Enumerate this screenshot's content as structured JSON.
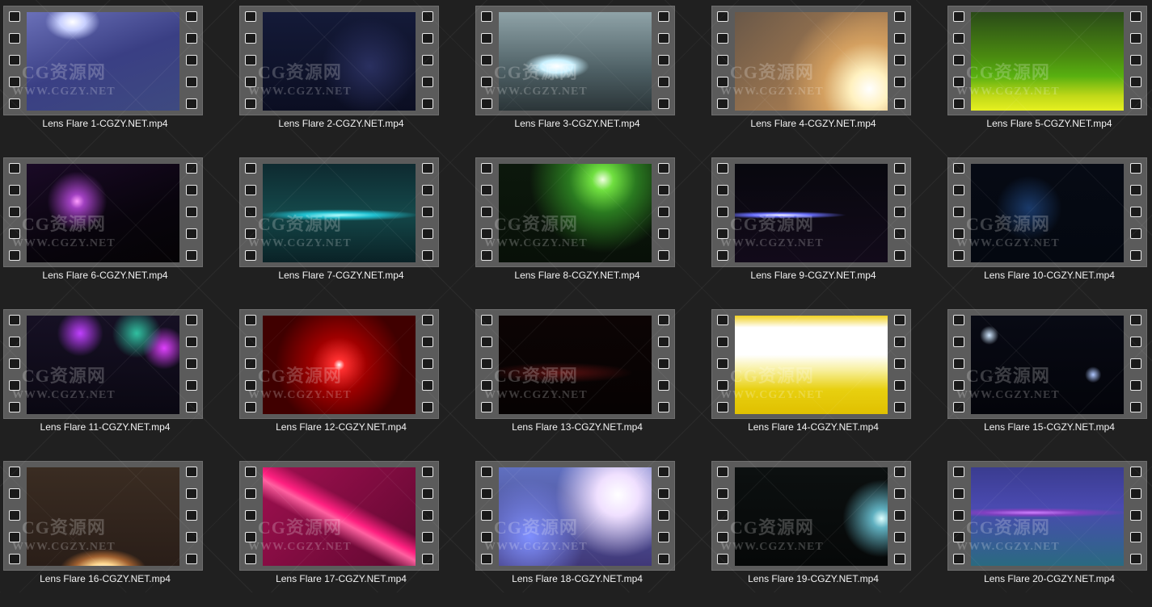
{
  "files": [
    {
      "name": "Lens Flare 1-CGZY.NET.mp4",
      "thumb_bg": "radial-gradient(ellipse 45px 30px at 30% 10%, #ffffff 0%, #c8d0ff 35%, transparent 75%), linear-gradient(160deg,#6a70b8 0%,#3a3f84 50%,#3e4a80 100%)"
    },
    {
      "name": "Lens Flare 2-CGZY.NET.mp4",
      "thumb_bg": "radial-gradient(circle at 70% 55%, #2a3060 0%, transparent 40%), linear-gradient(180deg,#141a38 0%,#0b0e22 100%)"
    },
    {
      "name": "Lens Flare 3-CGZY.NET.mp4",
      "thumb_bg": "radial-gradient(ellipse 50px 20px at 38% 55%, #ffffff 0%, #c9f1ff 40%, transparent 80%), linear-gradient(180deg,#8fa3a8 0%,#4d5f64 60%,#2b3538 100%)"
    },
    {
      "name": "Lens Flare 4-CGZY.NET.mp4",
      "thumb_bg": "radial-gradient(circle at 88% 78%, #ffffff 0%, #fff1c0 12%, #d4a060 30%, transparent 55%), linear-gradient(135deg,#6a5848 0%,#a07850 60%,#b08050 100%)"
    },
    {
      "name": "Lens Flare 5-CGZY.NET.mp4",
      "thumb_bg": "linear-gradient(180deg,#2a4a18 0%,#4a8a10 45%,#58b010 65%,#c0d818 85%,#e6f020 100%)"
    },
    {
      "name": "Lens Flare 6-CGZY.NET.mp4",
      "thumb_bg": "radial-gradient(circle at 33% 38%, #ff9cff 0%, #a040c0 6%, transparent 25%), linear-gradient(160deg,#1a0a26 0%,#08040c 60%,#050305 100%)"
    },
    {
      "name": "Lens Flare 7-CGZY.NET.mp4",
      "thumb_bg": "radial-gradient(ellipse 110px 8px at 50% 52%, #b0ffff 0%, #20c0d0 40%, transparent 90%), linear-gradient(180deg,#0e2a30 0%,#14484a 50%,#0a2226 100%)"
    },
    {
      "name": "Lens Flare 8-CGZY.NET.mp4",
      "thumb_bg": "radial-gradient(circle at 68% 16%, #f0ffe0 0%, #70e040 8%, #2a7a20 25%, transparent 55%), linear-gradient(180deg,#0c180c 0%,#081008 100%)"
    },
    {
      "name": "Lens Flare 9-CGZY.NET.mp4",
      "thumb_bg": "radial-gradient(ellipse 90px 5px at 30% 52%, #ffffff 0%, #6a70ff 40%, transparent 90%), linear-gradient(180deg,#08080e 0%,#120a1a 100%)"
    },
    {
      "name": "Lens Flare 10-CGZY.NET.mp4",
      "thumb_bg": "radial-gradient(circle at 38% 45%, #1a3a6a 0%, transparent 30%), linear-gradient(180deg,#060a14 0%,#040810 100%)"
    },
    {
      "name": "Lens Flare 11-CGZY.NET.mp4",
      "thumb_bg": "radial-gradient(circle at 35% 18%, #c040ff 0%, transparent 18%), radial-gradient(circle at 72% 18%, #30c0a0 0%, transparent 18%), radial-gradient(circle at 90% 33%, #e040ff 0%, transparent 14%), linear-gradient(180deg,#161024 0%,#0a0812 100%)"
    },
    {
      "name": "Lens Flare 12-CGZY.NET.mp4",
      "thumb_bg": "radial-gradient(circle at 50% 50%, #ffffff 0%, #ff3030 6%, #a00000 30%, #400000 70%), #200000"
    },
    {
      "name": "Lens Flare 13-CGZY.NET.mp4",
      "thumb_bg": "radial-gradient(ellipse 100px 14px at 40% 58%, #5a1010 0%, transparent 90%), linear-gradient(180deg,#0c0404 0%,#060202 100%)"
    },
    {
      "name": "Lens Flare 14-CGZY.NET.mp4",
      "thumb_bg": "linear-gradient(180deg,#f0d020 0%,#ffffff 12%,#ffffff 40%,#f8f0a0 55%,#e8d010 75%,#e0c000 100%)"
    },
    {
      "name": "Lens Flare 15-CGZY.NET.mp4",
      "thumb_bg": "radial-gradient(circle at 12% 20%, #d0e8ff 0%, transparent 6%), radial-gradient(circle at 80% 60%, #b0c8ff 0%, transparent 6%), linear-gradient(180deg,#080a14 0%,#03040a 100%)"
    },
    {
      "name": "Lens Flare 16-CGZY.NET.mp4",
      "thumb_bg": "radial-gradient(ellipse 60px 30px at 50% 105%, #ffffff 0%, #ffd890 30%, #a06030 60%, transparent 90%), linear-gradient(180deg,#3a2c22 0%,#2a1e18 100%)"
    },
    {
      "name": "Lens Flare 17-CGZY.NET.mp4",
      "thumb_bg": "linear-gradient(28deg, transparent 38%, #ff60a0 48%, #ff2080 52%, transparent 62%), linear-gradient(135deg,#a01050 0%,#600830 100%)"
    },
    {
      "name": "Lens Flare 18-CGZY.NET.mp4",
      "thumb_bg": "radial-gradient(circle at 78% 28%, #ffffff 0%, #f0e0ff 15%, transparent 45%), radial-gradient(circle at 20% 70%, #8090ff 0%, transparent 40%), linear-gradient(180deg,#6070c0 0%,#403878 100%)"
    },
    {
      "name": "Lens Flare 19-CGZY.NET.mp4",
      "thumb_bg": "radial-gradient(circle at 96% 52%, #e0ffff 0%, #60b0c0 6%, transparent 25%), linear-gradient(180deg,#0c1010 0%,#060808 100%)"
    },
    {
      "name": "Lens Flare 20-CGZY.NET.mp4",
      "thumb_bg": "radial-gradient(ellipse 120px 6px at 40% 46%, #d080ff 0%, #8040c0 50%, transparent 100%), linear-gradient(180deg,#3a3c90 0%,#4a4ab0 40%,#3a5a9a 70%,#2a6a80 100%)"
    }
  ],
  "watermark": {
    "cn": "CG资源网",
    "en": "WWW.CGZY.NET"
  }
}
